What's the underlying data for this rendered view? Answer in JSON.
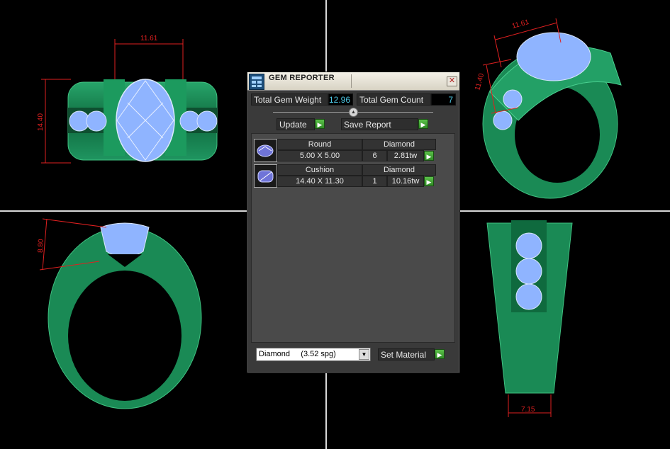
{
  "dimensions": {
    "top_view_width": "11.61",
    "top_view_height": "14.40",
    "iso_view_width": "11.61",
    "iso_view_height": "11.40",
    "front_view_height": "8.80",
    "side_view_width": "7.15"
  },
  "panel": {
    "title": "GEM REPORTER",
    "close_glyph": "✕",
    "total_weight_label": "Total Gem Weight",
    "total_weight_value": "12.96",
    "total_count_label": "Total Gem Count",
    "total_count_value": "7",
    "update_label": "Update",
    "save_report_label": "Save Report",
    "gems": [
      {
        "shape": "Round",
        "material": "Diamond",
        "size": "5.00 X 5.00",
        "count": "6",
        "weight": "2.81tw"
      },
      {
        "shape": "Cushion",
        "material": "Diamond",
        "size": "14.40 X 11.30",
        "count": "1",
        "weight": "10.16tw"
      }
    ],
    "material_selected": "Diamond     (3.52 spg)",
    "set_material_label": "Set Material"
  },
  "colors": {
    "ring_metal": "#1a8a55",
    "gem": "#8fb4ff",
    "dimension": "#e02020",
    "value_text": "#4ec9e6",
    "go_button": "#3fa832"
  },
  "icons": [
    "gem-reporter-icon",
    "close-icon",
    "slider-knob-icon",
    "play-arrow-icon",
    "dropdown-arrow-icon",
    "round-gem-icon",
    "cushion-gem-icon"
  ]
}
